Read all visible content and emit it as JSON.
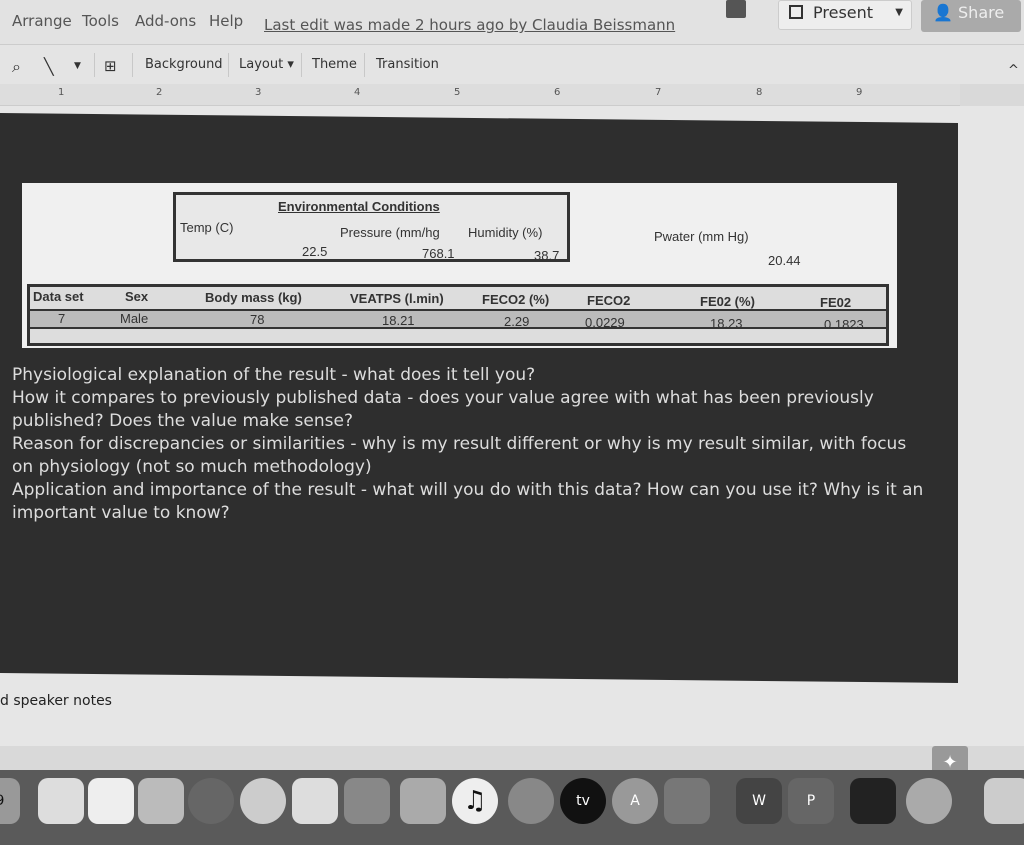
{
  "menu": {
    "items": [
      "Arrange",
      "Tools",
      "Add-ons",
      "Help"
    ],
    "last_edit": "Last edit was made 2 hours ago by Claudia Beissmann",
    "present": "Present",
    "share": "Share"
  },
  "toolbar": {
    "background": "Background",
    "layout": "Layout ▾",
    "theme": "Theme",
    "transition": "Transition"
  },
  "ruler": [
    "1",
    "2",
    "3",
    "4",
    "5",
    "6",
    "7",
    "8",
    "9"
  ],
  "env": {
    "title": "Environmental Conditions",
    "temp_label": "Temp (C)",
    "pressure_label": "Pressure (mm/hg",
    "humidity_label": "Humidity (%)",
    "temp": "22.5",
    "pressure": "768.1",
    "humidity": "38.7",
    "pwater_label": "Pwater (mm Hg)",
    "pwater": "20.44"
  },
  "data_table": {
    "headers": [
      "Data set",
      "Sex",
      "Body mass (kg)",
      "VEATPS (l.min)",
      "FECO2 (%)",
      "FECO2",
      "FE02 (%)",
      "FE02"
    ],
    "row": [
      "7",
      "Male",
      "78",
      "18.21",
      "2.29",
      "0.0229",
      "18.23",
      "0.1823"
    ]
  },
  "questions": [
    "Physiological explanation of the result - what does it tell you?",
    "How it compares to previously published data - does your value agree with what has been previously published? Does the value make sense?",
    "Reason for discrepancies or similarities - why is my result different or why is my result similar, with focus on physiology (not so much methodology)",
    "Application and importance of the result - what will you do with this data? How can you use it? Why is it an important value to know?"
  ],
  "notes": "d speaker notes",
  "dock": [
    "9",
    "",
    "",
    "",
    "",
    "",
    "",
    "",
    "",
    "",
    "♫",
    "",
    "tv",
    "A",
    "",
    "W",
    "P",
    "",
    "",
    ""
  ]
}
